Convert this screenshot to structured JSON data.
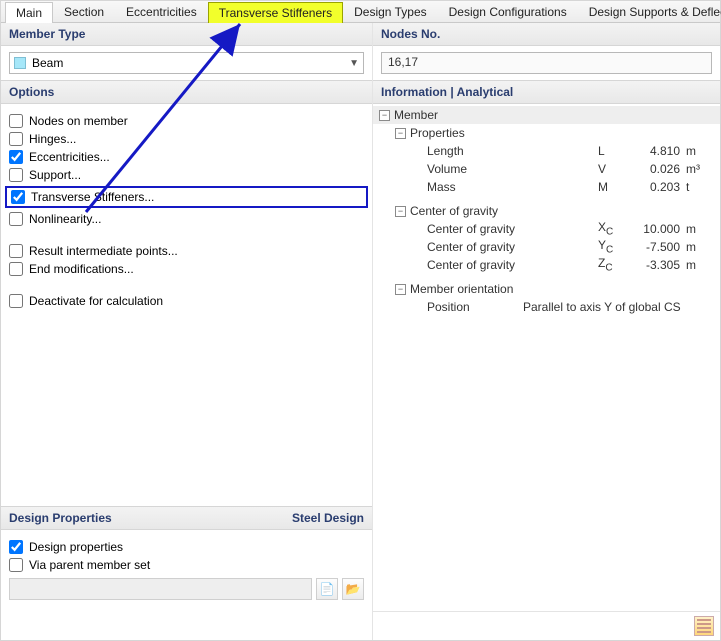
{
  "tabs": [
    "Main",
    "Section",
    "Eccentricities",
    "Transverse Stiffeners",
    "Design Types",
    "Design Configurations",
    "Design Supports & Deflection"
  ],
  "tabs_active_index": 0,
  "tabs_highlight_index": 3,
  "left": {
    "member_type_label": "Member Type",
    "member_type_value": "Beam",
    "options_label": "Options",
    "options": [
      {
        "label": "Nodes on member",
        "checked": false
      },
      {
        "label": "Hinges...",
        "checked": false
      },
      {
        "label": "Eccentricities...",
        "checked": true
      },
      {
        "label": "Support...",
        "checked": false
      },
      {
        "label": "Transverse Stiffeners...",
        "checked": true,
        "emphasized": true
      },
      {
        "label": "Nonlinearity...",
        "checked": false
      },
      {
        "label": "Result intermediate points...",
        "checked": false
      },
      {
        "label": "End modifications...",
        "checked": false
      },
      {
        "label": "Deactivate for calculation",
        "checked": false
      }
    ],
    "design_props_label": "Design Properties",
    "design_right_label": "Steel Design",
    "design_checks": [
      {
        "label": "Design properties",
        "checked": true
      },
      {
        "label": "Via parent member set",
        "checked": false
      }
    ]
  },
  "right": {
    "nodes_label": "Nodes No.",
    "nodes_value": "16,17",
    "info_label": "Information | Analytical",
    "tree": {
      "member": "Member",
      "groups": [
        {
          "title": "Properties",
          "rows": [
            {
              "label": "Length",
              "sym": "L",
              "val": "4.810",
              "unit": "m"
            },
            {
              "label": "Volume",
              "sym": "V",
              "val": "0.026",
              "unit": "m³"
            },
            {
              "label": "Mass",
              "sym": "M",
              "val": "0.203",
              "unit": "t"
            }
          ]
        },
        {
          "title": "Center of gravity",
          "rows": [
            {
              "label": "Center of gravity",
              "sym_html": "X<span class='subc'>C</span>",
              "val": "10.000",
              "unit": "m"
            },
            {
              "label": "Center of gravity",
              "sym_html": "Y<span class='subc'>C</span>",
              "val": "-7.500",
              "unit": "m"
            },
            {
              "label": "Center of gravity",
              "sym_html": "Z<span class='subc'>C</span>",
              "val": "-3.305",
              "unit": "m"
            }
          ]
        },
        {
          "title": "Member orientation",
          "rows": [
            {
              "label": "Position",
              "wide": "Parallel to axis Y of global CS"
            }
          ]
        }
      ]
    }
  }
}
